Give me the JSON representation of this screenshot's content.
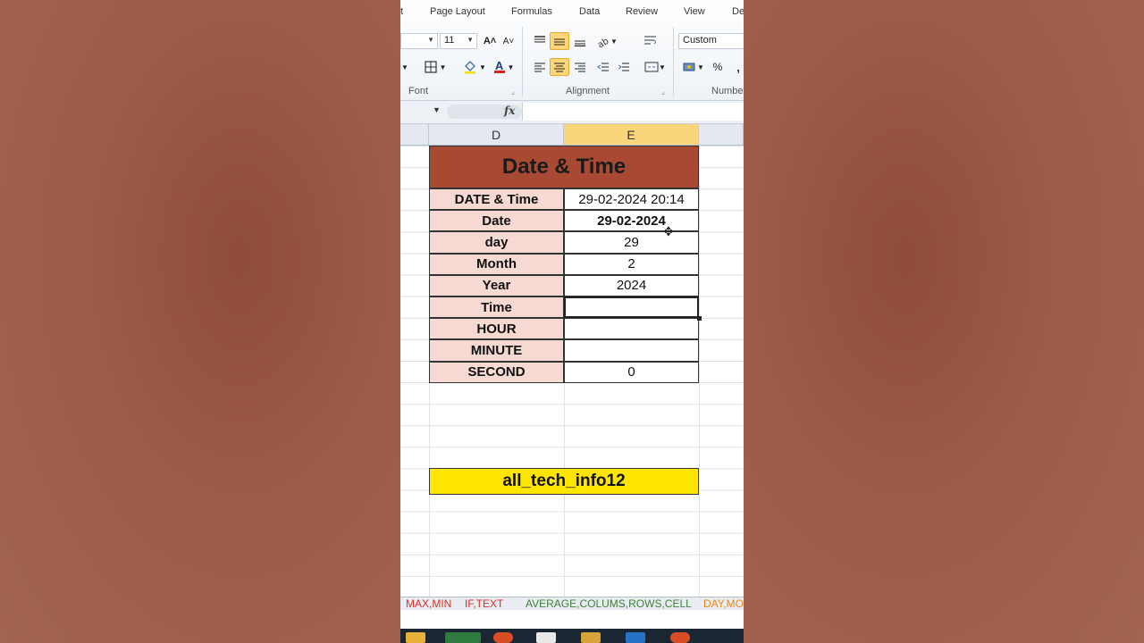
{
  "ribbon": {
    "tabs": [
      "t",
      "Page Layout",
      "Formulas",
      "Data",
      "Review",
      "View",
      "De"
    ],
    "font_size": "11",
    "number_format": "Custom",
    "groups": {
      "font": "Font",
      "alignment": "Alignment",
      "number": "Numbe"
    },
    "icons": {
      "grow": "A˄",
      "shrink": "A˅",
      "percent": "%",
      "comma": ",",
      "fx": "fx"
    }
  },
  "columns": [
    "D",
    "E"
  ],
  "table": {
    "title": "Date & Time",
    "rows": [
      {
        "label": "DATE & Time",
        "value": "29-02-2024 20:14"
      },
      {
        "label": "Date",
        "value": "29-02-2024"
      },
      {
        "label": "day",
        "value": "29"
      },
      {
        "label": "Month",
        "value": "2"
      },
      {
        "label": "Year",
        "value": "2024"
      },
      {
        "label": "Time",
        "value": ""
      },
      {
        "label": "HOUR",
        "value": ""
      },
      {
        "label": "MINUTE",
        "value": ""
      },
      {
        "label": "SECOND",
        "value": "0"
      }
    ]
  },
  "brand": "all_tech_info12",
  "sheet_tabs": [
    "MAX,MIN",
    "IF,TEXT",
    "AVERAGE,COLUMS,ROWS,CELL",
    "DAY,MO"
  ],
  "colors": {
    "title_bg": "#a84a33",
    "label_bg": "#f5d9d2",
    "brand_bg": "#ffe600",
    "selected_col": "#f9d57c"
  }
}
